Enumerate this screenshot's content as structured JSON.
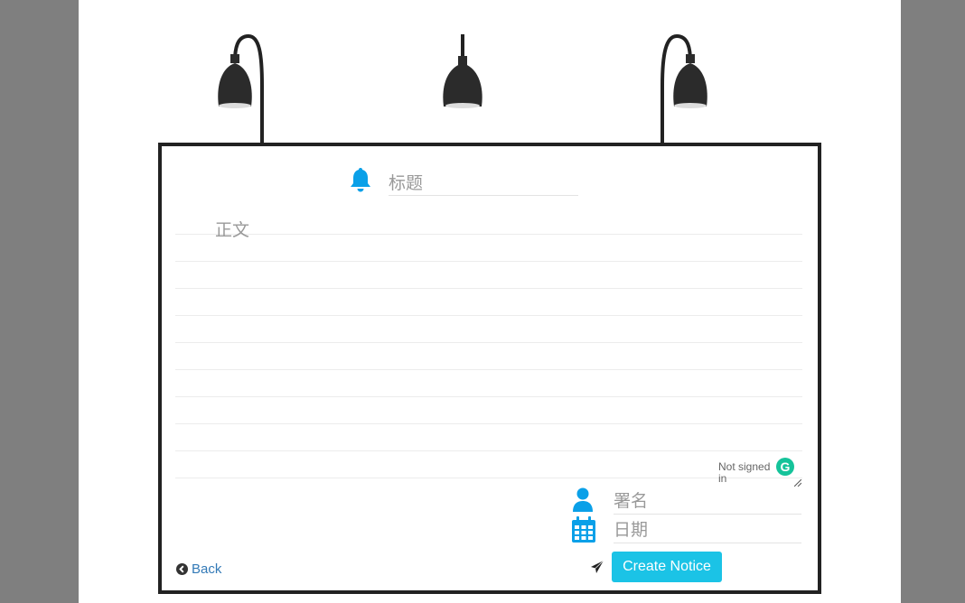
{
  "form": {
    "title_placeholder": "标题",
    "body_placeholder": "正文",
    "signature_placeholder": "署名",
    "date_placeholder": "日期"
  },
  "grammarly": {
    "status": "Not signed in",
    "icon_letter": "G"
  },
  "actions": {
    "back_label": "Back",
    "create_label": "Create Notice"
  },
  "icons": {
    "title": "bell-icon",
    "signature": "user-icon",
    "date": "calendar-icon",
    "back": "chevron-circle-left-icon",
    "create": "paper-plane-icon"
  },
  "colors": {
    "accent": "#1bc3e6",
    "icon_blue": "#0aa0e8",
    "link": "#337ab7",
    "border": "#222222",
    "grammarly": "#15c39a"
  }
}
